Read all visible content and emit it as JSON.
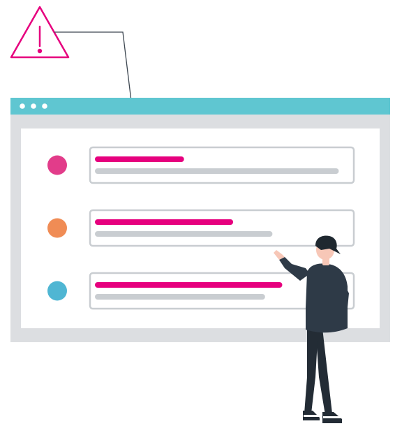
{
  "colors": {
    "accent": "#E6007E",
    "titlebar": "#5FC6D1",
    "window_frame": "#DCDEE1",
    "content_bg": "#FFFFFF",
    "card_border": "#C9CDD1",
    "line_gray": "#C9CDD1",
    "dot_pink": "#E23C8A",
    "dot_orange": "#F08C55",
    "dot_blue": "#4FB6D3",
    "person_shirt": "#2E3A47",
    "person_pants": "#232C35",
    "skin": "#F7C7B7",
    "hair": "#1F2830"
  },
  "icons": {
    "warning": "warning-triangle-icon",
    "window_controls": "window-dots-icon"
  },
  "list": {
    "items": [
      {
        "status": "pink",
        "title_fill": 0.34,
        "sub_fill": 0.97
      },
      {
        "status": "orange",
        "title_fill": 0.54,
        "sub_fill": 0.7
      },
      {
        "status": "blue",
        "title_fill": 0.74,
        "sub_fill": 0.67
      }
    ]
  }
}
